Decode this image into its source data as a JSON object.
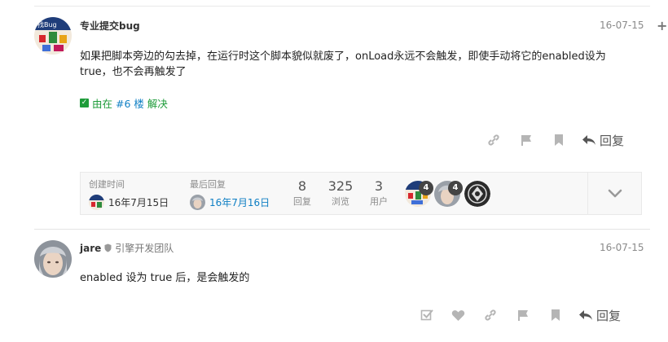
{
  "colors": {
    "accent_link": "#0f7fc4",
    "solved_green": "#1e9c3a",
    "icon_gray": "#b5b5b5"
  },
  "post1": {
    "username": "专业提交bug",
    "date": "16-07-15",
    "line1": "如果把脚本旁边的勾去掉，在运行时这个脚本貌似就废了，onLoad永远不会触发，即使手动将它的enabled设为",
    "line2": "true，也不会再触发了",
    "solved_prefix": "由在",
    "solved_link": "#6 楼",
    "solved_suffix": "解决",
    "reply_label": "回复"
  },
  "topic_map": {
    "created_label": "创建时间",
    "created_value": "16年7月15日",
    "last_reply_label": "最后回复",
    "last_reply_value": "16年7月16日",
    "replies_count": "8",
    "replies_label": "回复",
    "views_count": "325",
    "views_label": "浏览",
    "users_count": "3",
    "users_label": "用户",
    "participants": [
      {
        "name": "专业提交bug",
        "count": "4"
      },
      {
        "name": "jare",
        "count": "4"
      },
      {
        "name": "shield",
        "count": ""
      }
    ]
  },
  "post2": {
    "username": "jare",
    "user_title": "引擎开发团队",
    "date": "16-07-15",
    "text": "enabled 设为 true 后，是会触发的",
    "reply_label": "回复"
  }
}
